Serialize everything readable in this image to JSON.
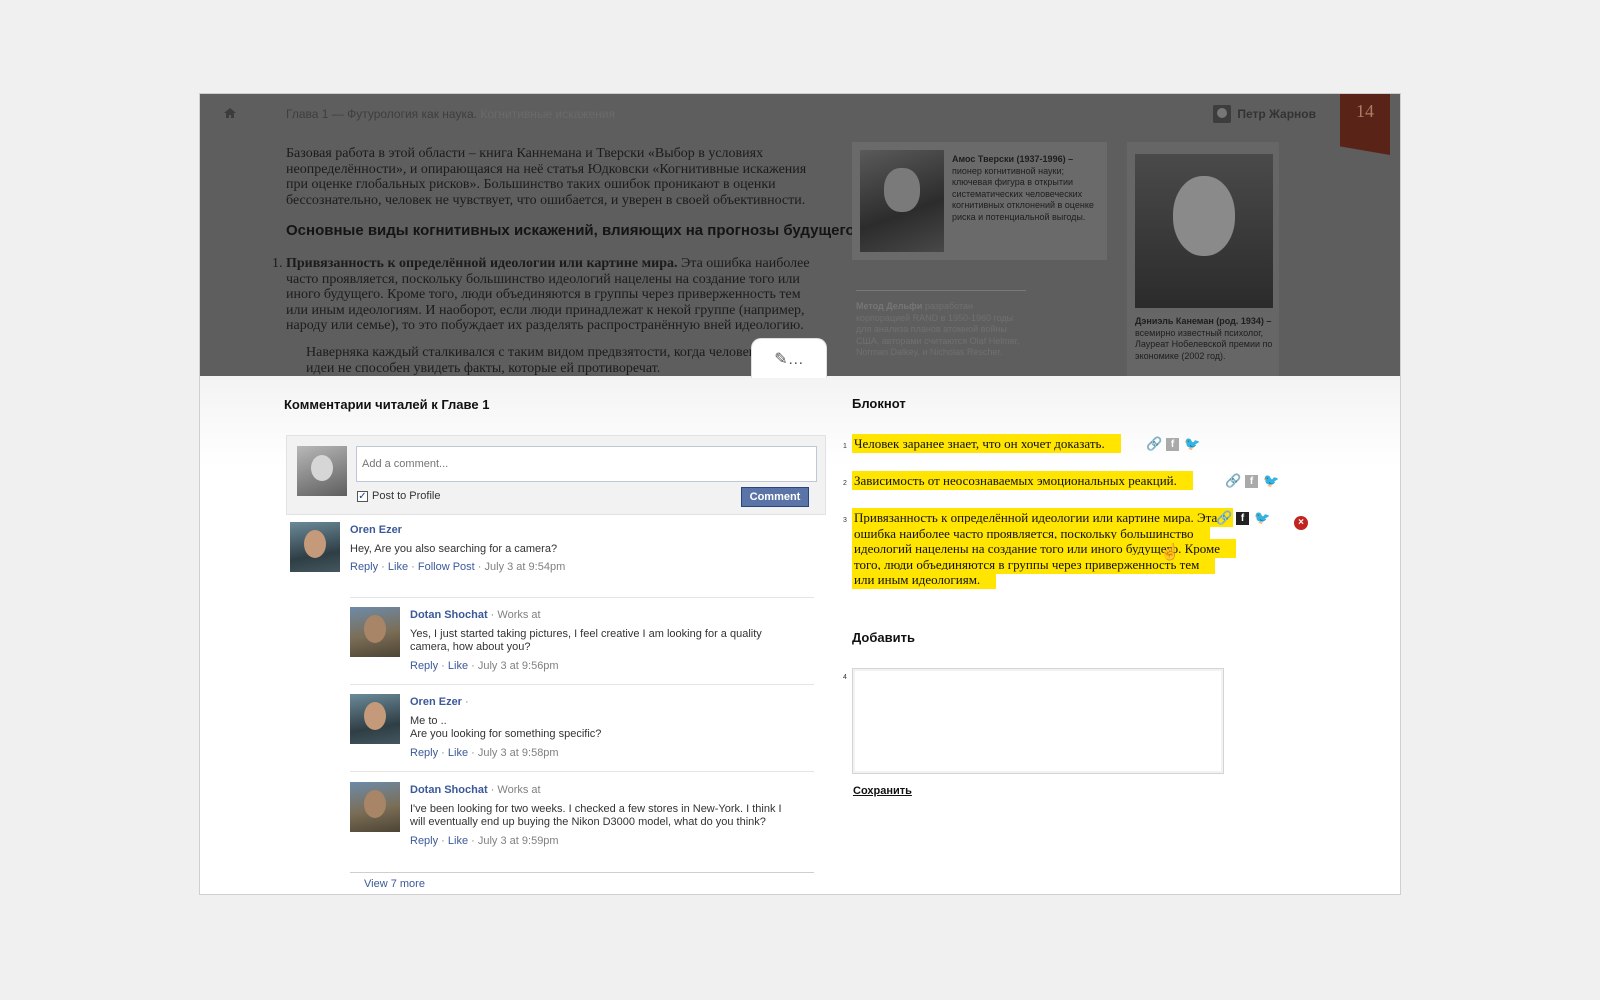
{
  "book": {
    "breadcrumb_chapter": "Глава 1 — Футурология как наука.",
    "breadcrumb_section": "Когнитивные искажения",
    "user_name": "Петр Жарнов",
    "page_number": "14",
    "paragraph_1": "Базовая работа в этой области – книга Каннемана и Тверски «Выбор в условиях неопределённости», и опирающаяся на неё статья Юдковски «Когнитивные искажения при оценке глобальных рисков». Большинство таких ошибок проникают в оценки бессознательно, человек не чувствует, что ошибается, и уверен в своей объективности.",
    "heading": "Основные виды когнитивных искажений, влияющих на прогнозы будущего",
    "list_item_1_number": "1.",
    "list_item_1_bold": "Привязанность к определённой идеологии или картине мира.",
    "list_item_1_text": " Эта ошибка наиболее часто проявляется, поскольку большинство идеологий нацелены на создание того или иного будущего. Кроме того, люди объединяются в группы через приверженность тем или иным идеологиям. И наоборот, если люди принадлежат к некой группе (например, народу или семье), то это побуждает их разделять распространённую вней идеологию.",
    "quote": "Наверняка каждый сталкивался с таким видом предвзятости, когда человек какой-либо идеи не способен увидеть факты, которые ей противоречат.",
    "card_tversky_name": "Амос Тверски (1937-1996) –",
    "card_tversky_text": "пионер когнитивной науки; ключевая фигура в открытии систематических человеческих когнитивных отклонений в оценке риска и потенциальной выгоды.",
    "card_kahneman_name": "Дэниэль Канеман (род. 1934) –",
    "card_kahneman_text": "всемирно известный психолог, Лауреат Нобелевской премии по экономике (2002 год).",
    "side_note_bold": "Метод Дельфи",
    "side_note_text": "разработан корпорацией RAND в 1950-1960 годы для анализа планов атомной войны США, авторами считаются Olaf Helmer, Norman Dalkey, и Nicholas Rescher."
  },
  "comments": {
    "title": "Комментарии читалей к Главе 1",
    "input_placeholder": "Add a comment...",
    "post_to_profile": "Post to Profile",
    "comment_button": "Comment",
    "view_more": "View 7 more",
    "items": [
      {
        "name": "Oren Ezer",
        "meta": "",
        "text": "Hey, Are you also searching for a camera?",
        "actions": [
          "Reply",
          "Like",
          "Follow Post"
        ],
        "time": "July 3 at 9:54pm"
      },
      {
        "name": "Dotan Shochat",
        "meta": " · Works at",
        "text": "Yes, I just started taking pictures, I feel creative I am looking for a quality camera, how about you?",
        "actions": [
          "Reply",
          "Like"
        ],
        "time": "July 3 at 9:56pm"
      },
      {
        "name": "Oren Ezer",
        "meta": " ·",
        "text": "Me to ..\nAre you looking for something specific?",
        "actions": [
          "Reply",
          "Like"
        ],
        "time": "July 3 at 9:58pm"
      },
      {
        "name": "Dotan Shochat",
        "meta": " · Works at",
        "text": "I've been looking for two weeks. I checked a few stores in New-York. I think I will eventually end up buying the Nikon D3000 model, what do you think?",
        "actions": [
          "Reply",
          "Like"
        ],
        "time": "July 3 at 9:59pm"
      }
    ]
  },
  "notebook": {
    "title": "Блокнот",
    "notes": [
      {
        "num": "1",
        "text": "Человек заранее знает, что он хочет доказать."
      },
      {
        "num": "2",
        "text": "Зависимость от неосознаваемых эмоциональных реакций."
      },
      {
        "num": "3",
        "text": "Привязанность к определённой идеологии или картине мира. Эта ошибка наиболее часто проявляется, поскольку большинство идеологий нацелены на создание того или иного будущего. Кроме того, люди объединяются в группы через приверженность тем или иным идеологиям."
      }
    ],
    "add_title": "Добавить",
    "new_num": "4",
    "save_label": "Сохранить"
  },
  "icons": {
    "home": "home-icon",
    "edit": "pencil-icon",
    "link": "link-icon",
    "facebook": "facebook-icon",
    "twitter": "twitter-icon",
    "delete": "delete-icon",
    "cursor": "hand-cursor-icon",
    "highlight_color": "#ffe500",
    "facebook_link_color": "#3b5998"
  }
}
